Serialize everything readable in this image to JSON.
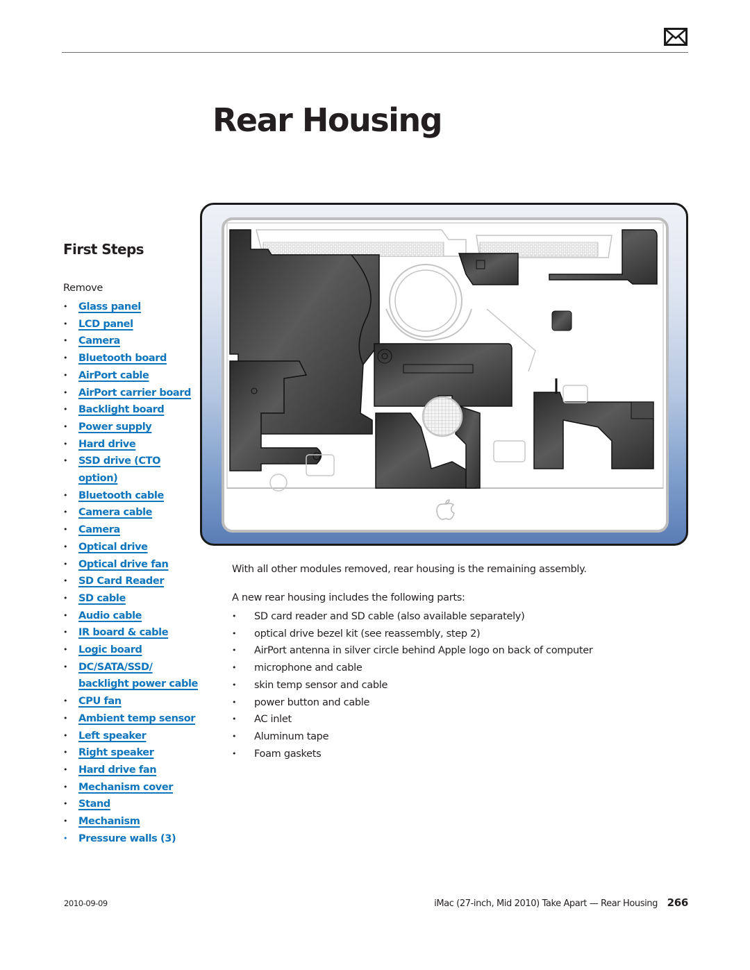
{
  "header": {
    "mail_icon": "envelope-icon"
  },
  "page_title": "Rear Housing",
  "first_steps": {
    "heading": "First Steps",
    "remove_label": "Remove",
    "items": [
      {
        "label": "Glass panel",
        "link": true
      },
      {
        "label": "LCD panel",
        "link": true
      },
      {
        "label": "Camera",
        "link": true
      },
      {
        "label": "Bluetooth board",
        "link": true
      },
      {
        "label": "AirPort cable",
        "link": true
      },
      {
        "label": "AirPort carrier board",
        "link": true
      },
      {
        "label": "Backlight board",
        "link": true
      },
      {
        "label": "Power supply",
        "link": true
      },
      {
        "label": "Hard drive",
        "link": true
      },
      {
        "label": "SSD drive (CTO",
        "label2": "option)",
        "link": true
      },
      {
        "label": "Bluetooth cable",
        "link": true
      },
      {
        "label": "Camera cable",
        "link": true
      },
      {
        "label": "Camera",
        "link": true
      },
      {
        "label": "Optical drive",
        "link": true
      },
      {
        "label": "Optical drive fan",
        "link": true
      },
      {
        "label": "SD Card Reader",
        "link": true
      },
      {
        "label": "SD cable",
        "link": true
      },
      {
        "label": "Audio cable",
        "link": true
      },
      {
        "label": "IR board & cable",
        "link": true
      },
      {
        "label": "Logic board",
        "link": true
      },
      {
        "label": "DC/SATA/SSD/",
        "label2": "backlight power cable",
        "link": true
      },
      {
        "label": "CPU fan",
        "link": true
      },
      {
        "label": "Ambient temp sensor",
        "link": true
      },
      {
        "label": "Left speaker",
        "link": true
      },
      {
        "label": "Right speaker",
        "link": true
      },
      {
        "label": "Hard drive fan",
        "link": true
      },
      {
        "label": "Mechanism cover",
        "link": true
      },
      {
        "label": "Stand",
        "link": true
      },
      {
        "label": "Mechanism",
        "link": true
      },
      {
        "label": "Pressure walls (3)",
        "link": false
      }
    ]
  },
  "figure": {
    "subject": "iMac rear housing illustration with remaining assembly",
    "frame_colors": {
      "top": "#eef1f7",
      "bottom": "#5a7db5",
      "border": "#1a1a1a"
    }
  },
  "content": {
    "intro": "With all other modules removed, rear housing is the remaining assembly.",
    "lead": "A new rear housing includes the following parts:",
    "parts": [
      "SD card reader and SD cable (also available separately)",
      "optical drive bezel kit (see reassembly, step 2)",
      "AirPort antenna in silver circle behind Apple logo on back of computer",
      "microphone and cable",
      "skin temp sensor and cable",
      "power button and cable",
      "AC inlet",
      "Aluminum tape",
      "Foam gaskets"
    ]
  },
  "footer": {
    "date": "2010-09-09",
    "title": "iMac (27-inch, Mid 2010) Take Apart — Rear Housing",
    "page_number": "266"
  },
  "colors": {
    "link": "#0f75bc",
    "text": "#231f20",
    "rule": "#6d6e71"
  }
}
